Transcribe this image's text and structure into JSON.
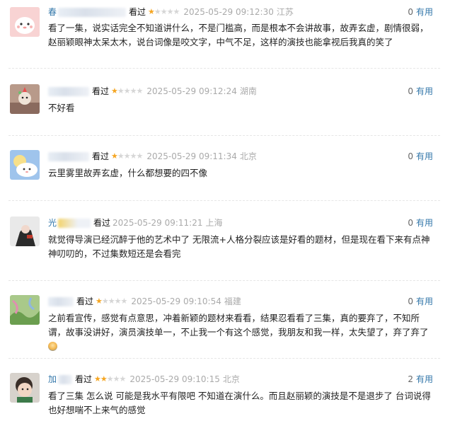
{
  "reviews": [
    {
      "name_visible": "春",
      "watched_label": "看过",
      "rating": 1,
      "time": "2025-05-29 09:12:30",
      "location": "江苏",
      "useful_count": "0",
      "useful_label": "有用",
      "content": "看了一集，说实话完全不知道讲什么，不是门槛高，而是根本不会讲故事，故弄玄虚，剧情很弱，赵丽颖眼神太呆太木，说台词像是咬文字，中气不足，这样的演技也能拿视后我真的笑了"
    },
    {
      "name_visible": "",
      "watched_label": "看过",
      "rating": 1,
      "time": "2025-05-29 09:12:24",
      "location": "湖南",
      "useful_count": "0",
      "useful_label": "有用",
      "content": "不好看"
    },
    {
      "name_visible": "",
      "watched_label": "看过",
      "rating": 1,
      "time": "2025-05-29 09:11:34",
      "location": "北京",
      "useful_count": "0",
      "useful_label": "有用",
      "content": "云里雾里故弄玄虚，什么都想要的四不像"
    },
    {
      "name_visible": "光",
      "watched_label": "看过",
      "rating": 0,
      "time": "2025-05-29 09:11:21",
      "location": "上海",
      "useful_count": "0",
      "useful_label": "有用",
      "content": "就觉得导演已经沉醉于他的艺术中了 无限流+人格分裂应该是好看的题材，但是现在看下来有点神神叨叨的，不过集数短还是会看完"
    },
    {
      "name_visible": "",
      "watched_label": "看过",
      "rating": 1,
      "time": "2025-05-29 09:10:54",
      "location": "福建",
      "useful_count": "0",
      "useful_label": "有用",
      "content": "之前看宣传，感觉有点意思，冲着新颖的题材来看看，结果忍看看了三集，真的要弃了，不知所谓，故事没讲好，演员演技单一，不止我一个有这个感觉，我朋友和我一样，太失望了，弃了弃了"
    },
    {
      "name_visible": "加",
      "watched_label": "看过",
      "rating": 2,
      "time": "2025-05-29 09:10:15",
      "location": "北京",
      "useful_count": "2",
      "useful_label": "有用",
      "content": "看了三集 怎么说 可能是我水平有限吧 不知道在演什么。而且赵丽颖的演技是不是退步了 台词说得也好想喘不上来气的感觉"
    }
  ],
  "colors": {
    "star_on": "#f5a623",
    "star_off": "#d6d6d6",
    "useful_link": "#3377aa",
    "meta_gray": "#aaaaaa"
  }
}
